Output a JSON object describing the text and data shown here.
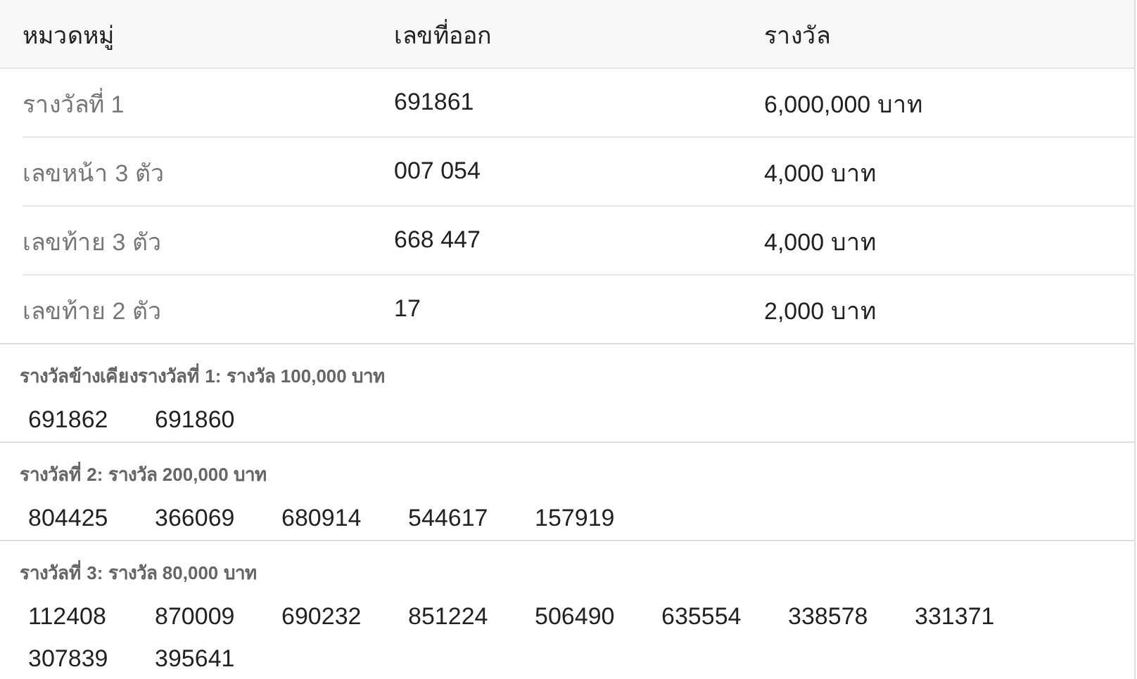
{
  "table": {
    "columns": [
      "หมวดหมู่",
      "เลขที่ออก",
      "รางวัล"
    ],
    "rows": [
      {
        "category": "รางวัลที่ 1",
        "number": "691861",
        "prize": "6,000,000 บาท"
      },
      {
        "category": "เลขหน้า 3 ตัว",
        "number": "007 054",
        "prize": "4,000 บาท"
      },
      {
        "category": "เลขท้าย 3 ตัว",
        "number": "668 447",
        "prize": "4,000 บาท"
      },
      {
        "category": "เลขท้าย 2 ตัว",
        "number": "17",
        "prize": "2,000 บาท"
      }
    ]
  },
  "prize_groups": [
    {
      "title": "รางวัลข้างเคียงรางวัลที่ 1: รางวัล 100,000 บาท",
      "numbers": [
        "691862",
        "691860"
      ]
    },
    {
      "title": "รางวัลที่ 2: รางวัล 200,000 บาท",
      "numbers": [
        "804425",
        "366069",
        "680914",
        "544617",
        "157919"
      ]
    },
    {
      "title": "รางวัลที่ 3: รางวัล 80,000 บาท",
      "numbers": [
        "112408",
        "870009",
        "690232",
        "851224",
        "506490",
        "635554",
        "338578",
        "331371",
        "307839",
        "395641"
      ]
    }
  ]
}
